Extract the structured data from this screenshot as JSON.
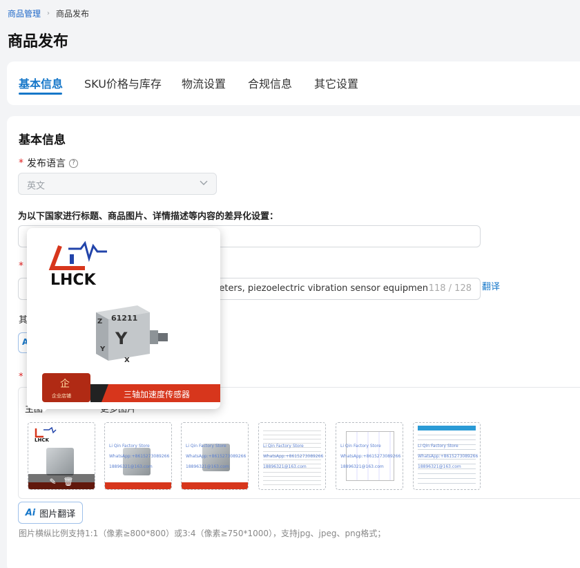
{
  "breadcrumb": {
    "parent": "商品管理",
    "current": "商品发布"
  },
  "page_title": "商品发布",
  "tabs": [
    {
      "label": "基本信息",
      "active": true
    },
    {
      "label": "SKU价格与库存",
      "active": false
    },
    {
      "label": "物流设置",
      "active": false
    },
    {
      "label": "合规信息",
      "active": false
    },
    {
      "label": "其它设置",
      "active": false
    }
  ],
  "section_title": "基本信息",
  "publish_language": {
    "required_mark": "*",
    "label": "发布语言",
    "help_icon": "?",
    "value": "英文"
  },
  "country_settings_label": "为以下国家进行标题、商品图片、详情描述等内容的差异化设置：",
  "title_field": {
    "required_mark": "*",
    "value": "ometers, piezoelectric vibration sensor equipmen",
    "counter": "118 / 128",
    "translate_label": "翻译"
  },
  "partial_label": "其",
  "ai_small_label": "A",
  "images": {
    "required_mark": "*",
    "more_images_label": "更多图片",
    "main_image_label": "主图",
    "watermark_store": "Li Qin Factory Store",
    "watermark_phone": "WhatsApp:+8615273089266",
    "watermark_email": "18896321@163.com",
    "thumb_caption": "三轴加速度传感器",
    "edit_icon": "✎",
    "delete_icon": "🗑"
  },
  "popup": {
    "brand": "LHCK",
    "cube_label": "61211",
    "axis_z": "Z",
    "axis_y": "Y",
    "axis_x": "X",
    "badge_text": "企业店铺",
    "banner_text": "三轴加速度传感器"
  },
  "ai_translate_button": {
    "ai_icon": "Ai",
    "label": "图片翻译"
  },
  "hint": "图片横纵比例支持1:1（像素≥800*800）或3:4（像素≥750*1000），支持jpg、jpeg、png格式；",
  "colors": {
    "accent": "#1677c9",
    "required": "#e02020",
    "brand_red": "#d7361c"
  }
}
